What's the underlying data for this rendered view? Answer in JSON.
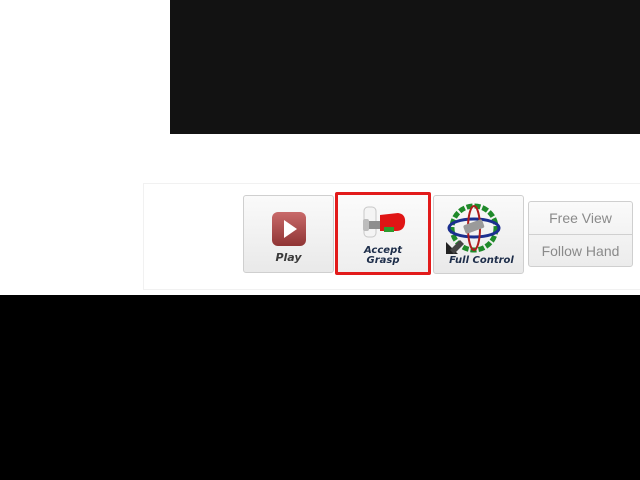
{
  "toolbar": {
    "play_label": "Play",
    "accept_grasp_label": "Accept Grasp",
    "full_control_label": "Full Control",
    "selected_highlight_color": "#e21b1b"
  },
  "view_mode": {
    "free_view_label": "Free View",
    "follow_hand_label": "Follow Hand"
  },
  "icons": {
    "play": "play-icon",
    "grasp": "gripper-icon",
    "full_control": "gimbal-icon"
  }
}
